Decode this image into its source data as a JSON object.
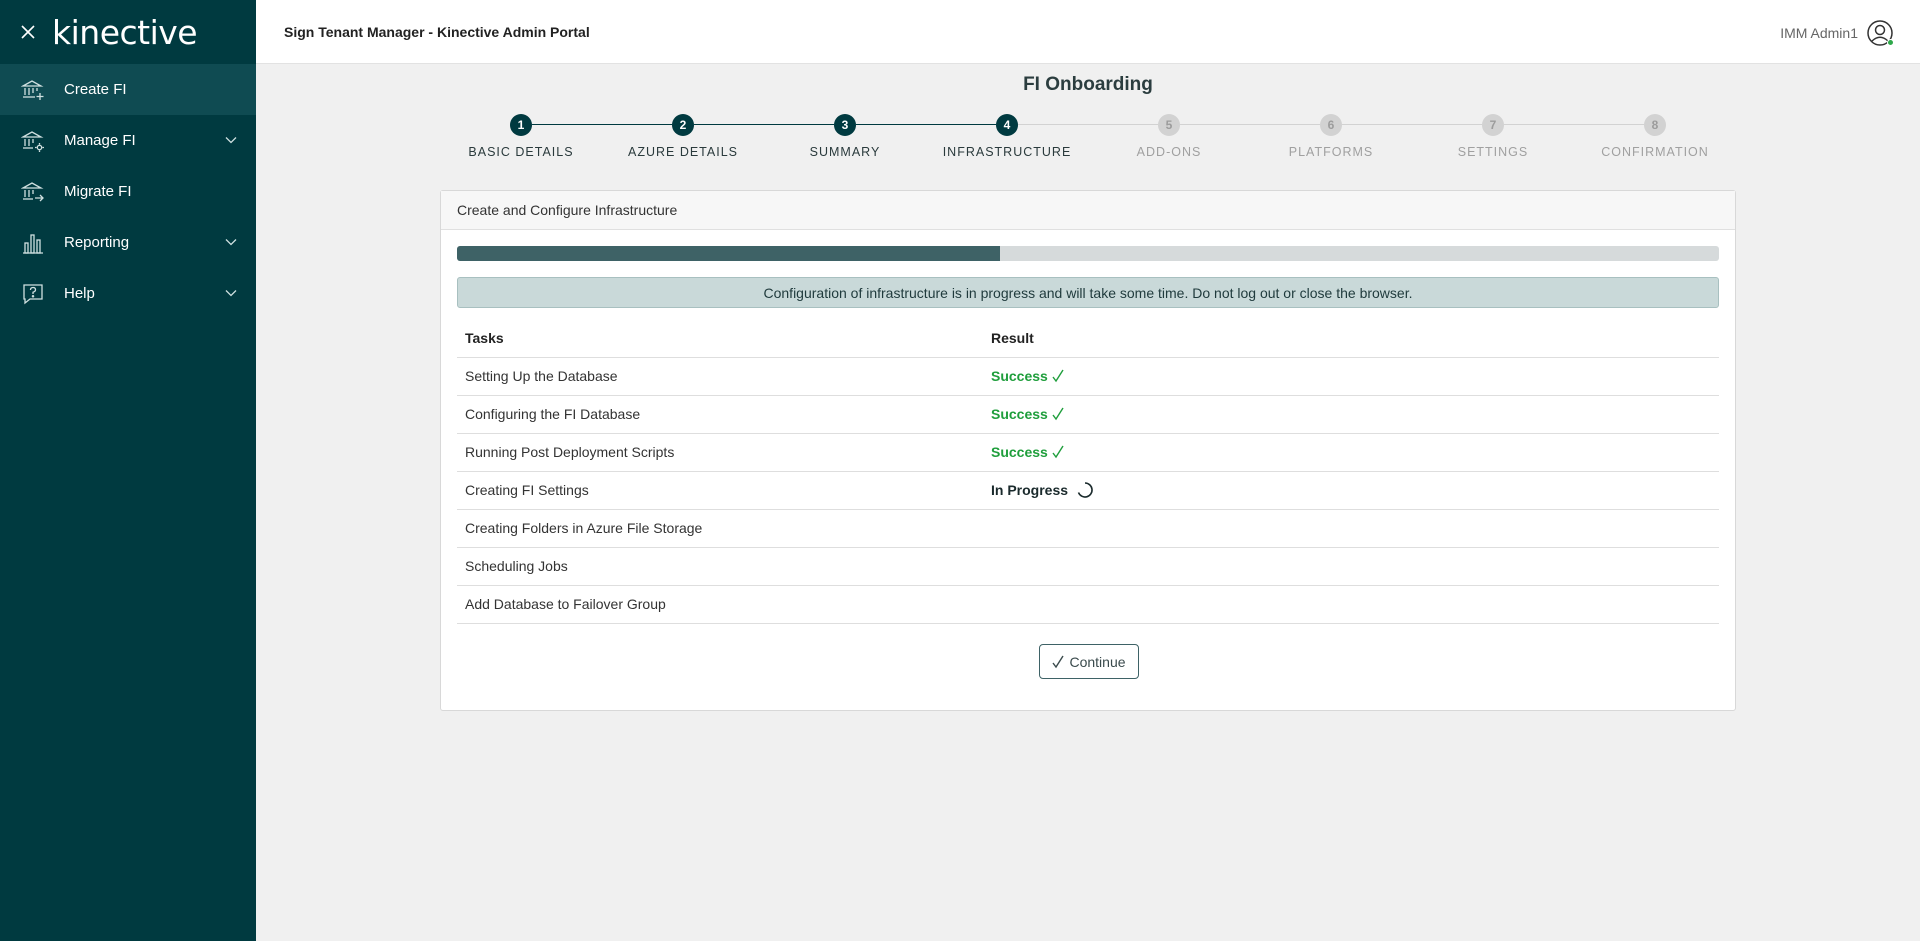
{
  "sidebar": {
    "logo": "kinective",
    "items": [
      {
        "label": "Create FI",
        "icon": "bank-add-icon",
        "active": true,
        "expandable": false
      },
      {
        "label": "Manage FI",
        "icon": "bank-settings-icon",
        "active": false,
        "expandable": true
      },
      {
        "label": "Migrate FI",
        "icon": "bank-migrate-icon",
        "active": false,
        "expandable": false
      },
      {
        "label": "Reporting",
        "icon": "bar-chart-icon",
        "active": false,
        "expandable": true
      },
      {
        "label": "Help",
        "icon": "help-bubble-icon",
        "active": false,
        "expandable": true
      }
    ]
  },
  "header": {
    "title": "Sign Tenant Manager - Kinective Admin Portal",
    "user_name": "IMM Admin1"
  },
  "page": {
    "title": "FI Onboarding"
  },
  "stepper": {
    "current": 4,
    "steps": [
      {
        "number": "1",
        "label": "BASIC DETAILS"
      },
      {
        "number": "2",
        "label": "AZURE DETAILS"
      },
      {
        "number": "3",
        "label": "SUMMARY"
      },
      {
        "number": "4",
        "label": "INFRASTRUCTURE"
      },
      {
        "number": "5",
        "label": "ADD-ONS"
      },
      {
        "number": "6",
        "label": "PLATFORMS"
      },
      {
        "number": "7",
        "label": "SETTINGS"
      },
      {
        "number": "8",
        "label": "CONFIRMATION"
      }
    ]
  },
  "card": {
    "title": "Create and Configure Infrastructure",
    "progress_fraction": 0.43,
    "alert": "Configuration of infrastructure is in progress and will take some time. Do not log out or close the browser.",
    "table": {
      "headers": [
        "Tasks",
        "Result"
      ],
      "rows": [
        {
          "task": "Setting Up the Database",
          "result": "Success",
          "status": "success"
        },
        {
          "task": "Configuring the FI Database",
          "result": "Success",
          "status": "success"
        },
        {
          "task": "Running Post Deployment Scripts",
          "result": "Success",
          "status": "success"
        },
        {
          "task": "Creating FI Settings",
          "result": "In Progress",
          "status": "in-progress"
        },
        {
          "task": "Creating Folders in Azure File Storage",
          "result": "",
          "status": "pending"
        },
        {
          "task": "Scheduling Jobs",
          "result": "",
          "status": "pending"
        },
        {
          "task": "Add Database to Failover Group",
          "result": "",
          "status": "pending"
        }
      ]
    },
    "continue_label": "Continue"
  },
  "colors": {
    "sidebar_bg": "#003a40",
    "sidebar_active": "#0f4b52",
    "accent": "#003a40",
    "success": "#1f9e3c",
    "progress_fill": "#3e6266"
  }
}
